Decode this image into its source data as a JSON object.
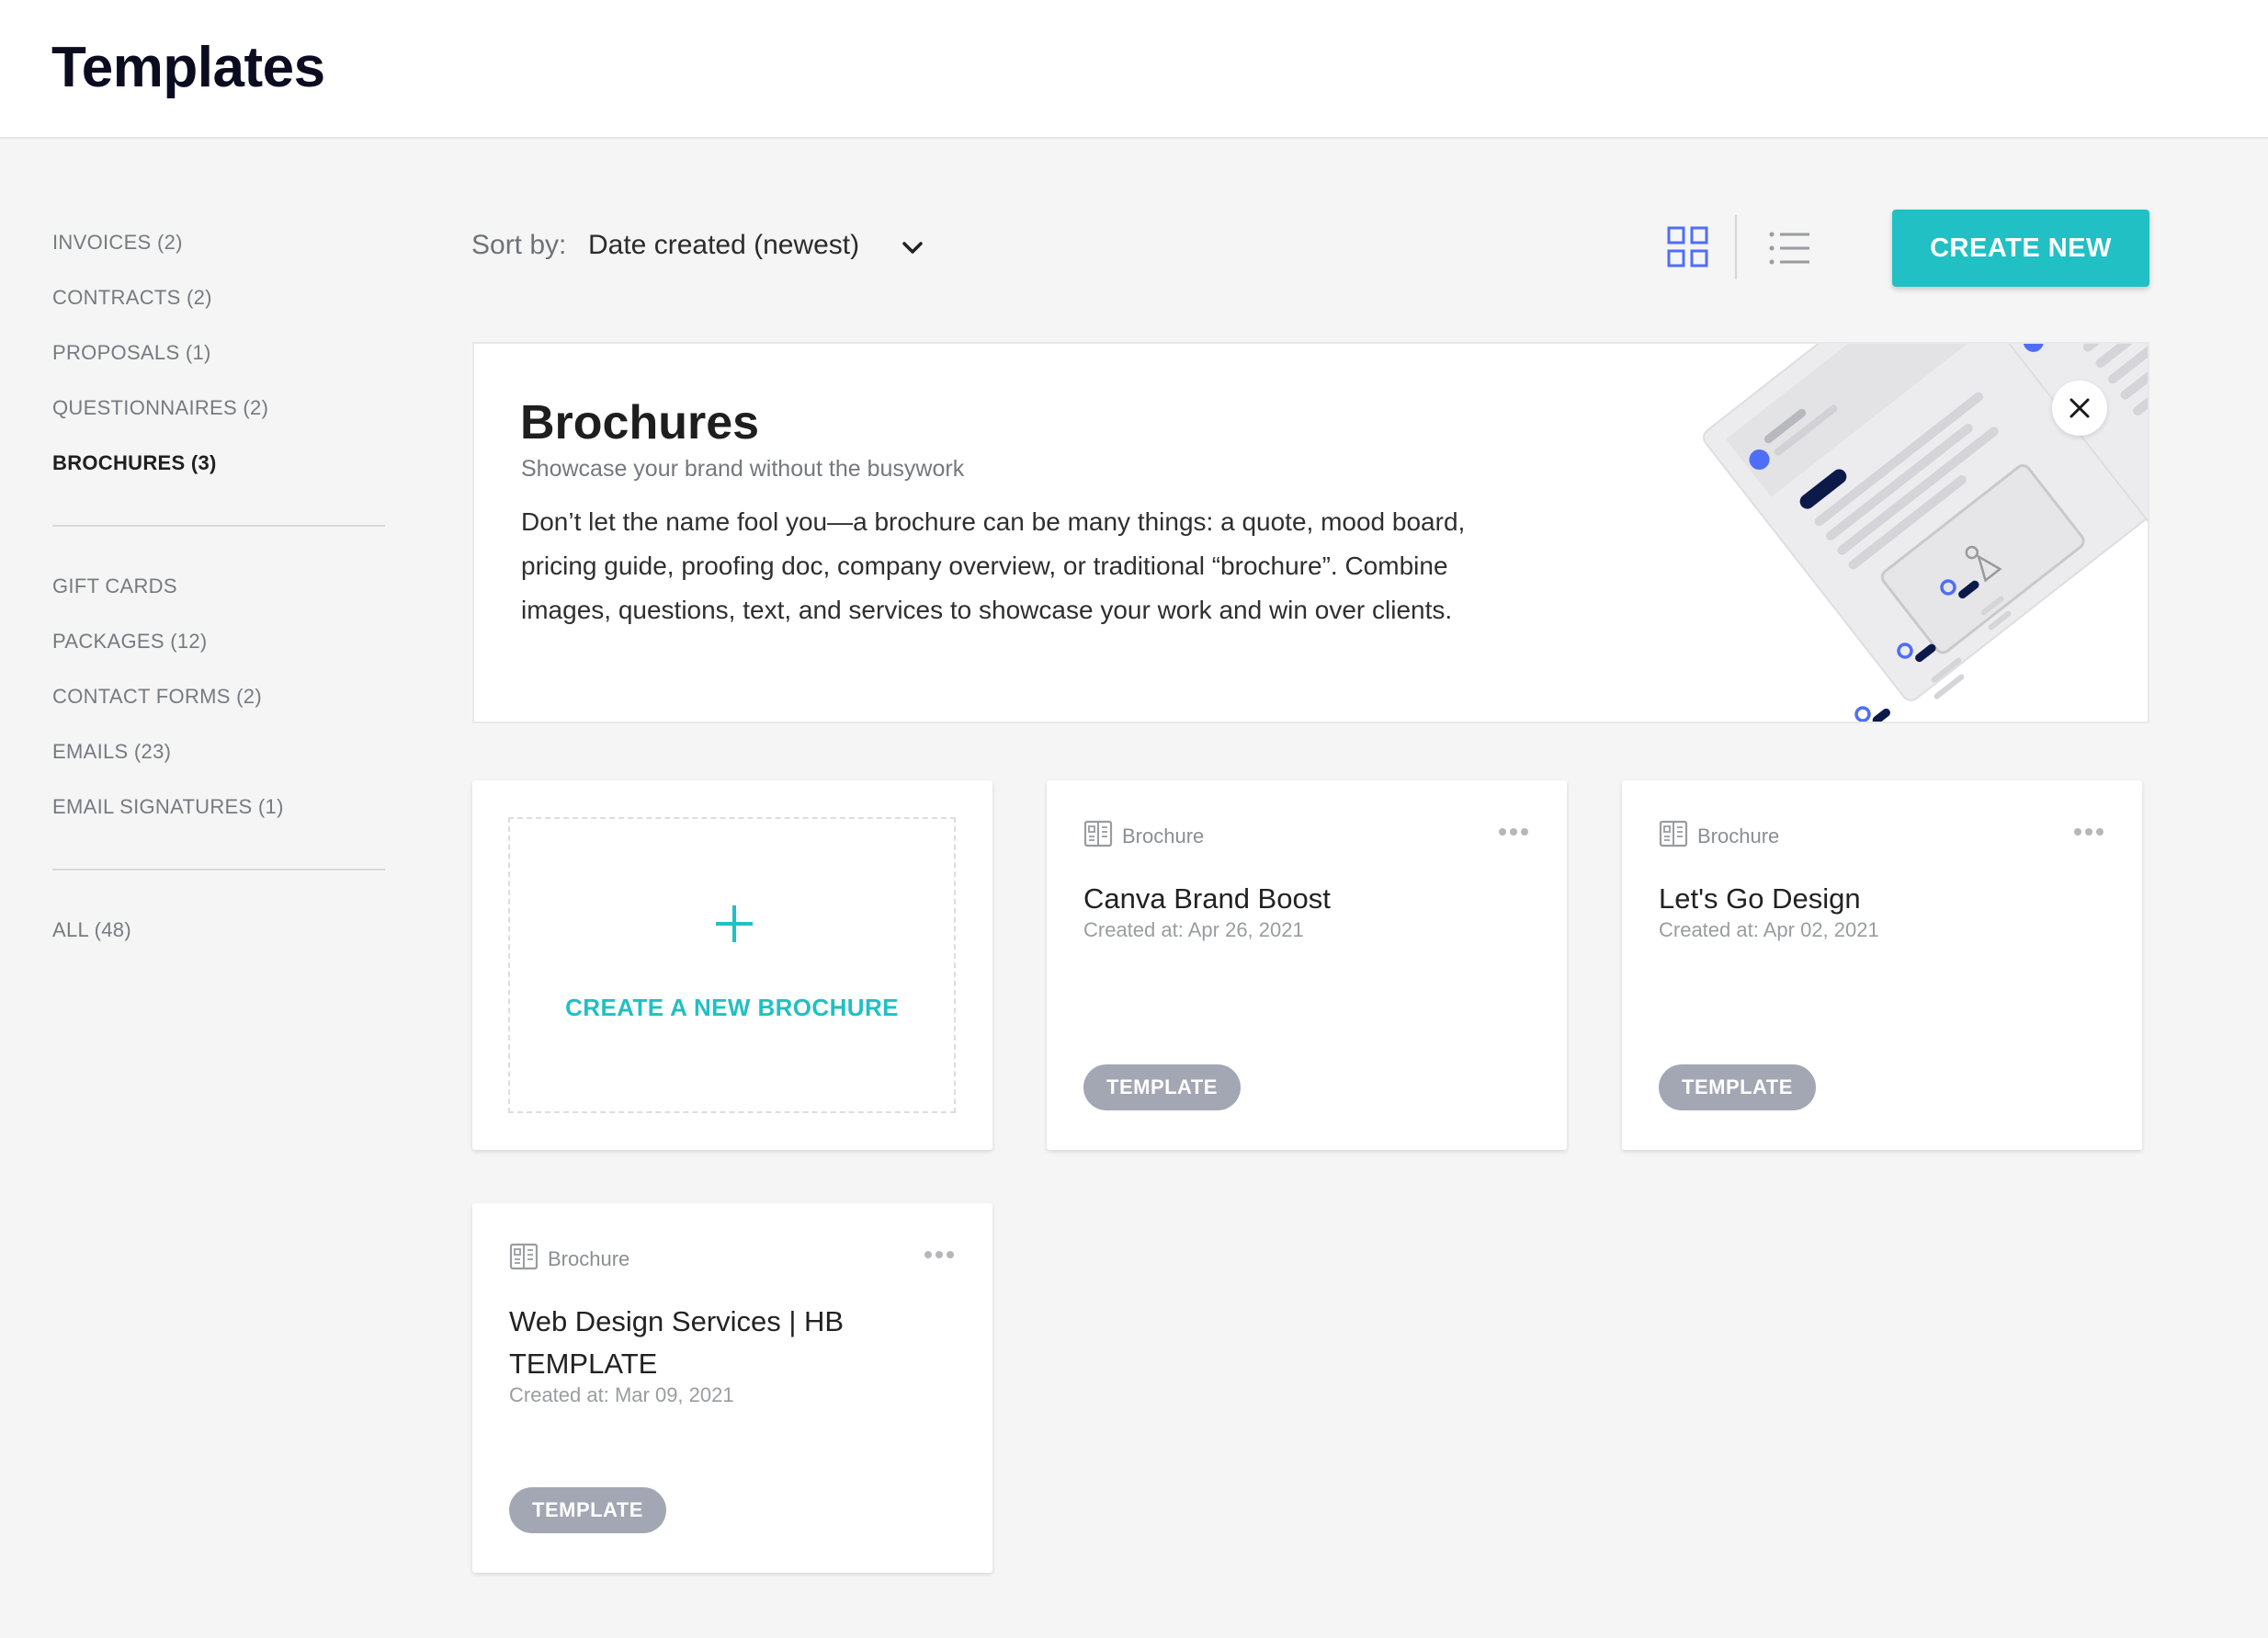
{
  "header": {
    "title": "Templates"
  },
  "sidebar": {
    "group1": [
      {
        "label": "INVOICES (2)"
      },
      {
        "label": "CONTRACTS (2)"
      },
      {
        "label": "PROPOSALS (1)"
      },
      {
        "label": "QUESTIONNAIRES (2)"
      },
      {
        "label": "BROCHURES (3)",
        "active": true
      }
    ],
    "group2": [
      {
        "label": "GIFT CARDS"
      },
      {
        "label": "PACKAGES (12)"
      },
      {
        "label": "CONTACT FORMS (2)"
      },
      {
        "label": "EMAILS (23)"
      },
      {
        "label": "EMAIL SIGNATURES (1)"
      }
    ],
    "group3": [
      {
        "label": "ALL (48)"
      }
    ]
  },
  "toolbar": {
    "sort_label": "Sort by:",
    "sort_value": "Date created (newest)",
    "view_mode": "grid",
    "create_new_label": "CREATE NEW"
  },
  "banner": {
    "title": "Brochures",
    "subtitle": "Showcase your brand without the busywork",
    "description": "Don’t let the name fool you—a brochure can be many things: a quote, mood board, pricing guide, proofing doc, company overview, or traditional “brochure”. Combine images, questions, text, and services to showcase your work and win over clients."
  },
  "create_card": {
    "label": "CREATE A NEW BROCHURE"
  },
  "cards": [
    {
      "type": "Brochure",
      "title": "Canva Brand Boost",
      "date": "Created at: Apr 26, 2021",
      "badge": "TEMPLATE"
    },
    {
      "type": "Brochure",
      "title": "Let's Go Design",
      "date": "Created at: Apr 02, 2021",
      "badge": "TEMPLATE"
    },
    {
      "type": "Brochure",
      "title": "Web Design Services | HB TEMPLATE",
      "date": "Created at: Mar 09, 2021",
      "badge": "TEMPLATE"
    }
  ],
  "colors": {
    "accent": "#20c0c4",
    "icon_blue": "#4f6ef7",
    "badge_gray": "#a3a7b3",
    "navy": "#0c1a4a"
  }
}
